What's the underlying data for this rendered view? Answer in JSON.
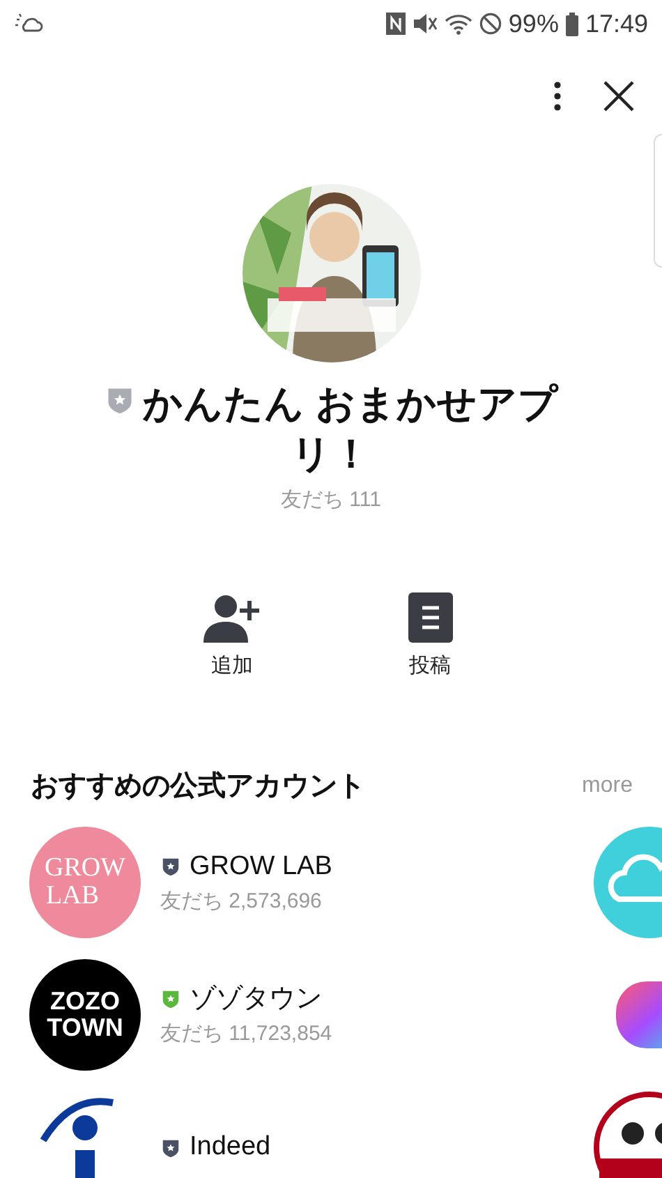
{
  "status_bar": {
    "battery": "99%",
    "time": "17:49"
  },
  "profile": {
    "color": "#a9acb2",
    "name": "かんたん おまかせアプリ！",
    "friends": "友だち 111"
  },
  "actions": [
    {
      "kind": "add",
      "label": "追加"
    },
    {
      "kind": "posts",
      "label": "投稿"
    }
  ],
  "recommended": {
    "title": "おすすめの公式アカウント",
    "more": "more",
    "accounts": [
      {
        "kind": "growlab",
        "logo_text": "GROW LAB",
        "name": "GROW LAB",
        "color": "#4b5165",
        "friends": "友だち 2,573,696"
      },
      {
        "kind": "zozo",
        "logo_text": "ZOZO TOWN",
        "name": "ゾゾタウン",
        "color": "#5ab93c",
        "friends": "友だち 11,723,854"
      },
      {
        "kind": "indeed",
        "name": "Indeed",
        "color": "#4b5165"
      }
    ],
    "side_logos": [
      {
        "kind": "cloud"
      },
      {
        "kind": "gradient"
      },
      {
        "kind": "panda"
      }
    ]
  }
}
